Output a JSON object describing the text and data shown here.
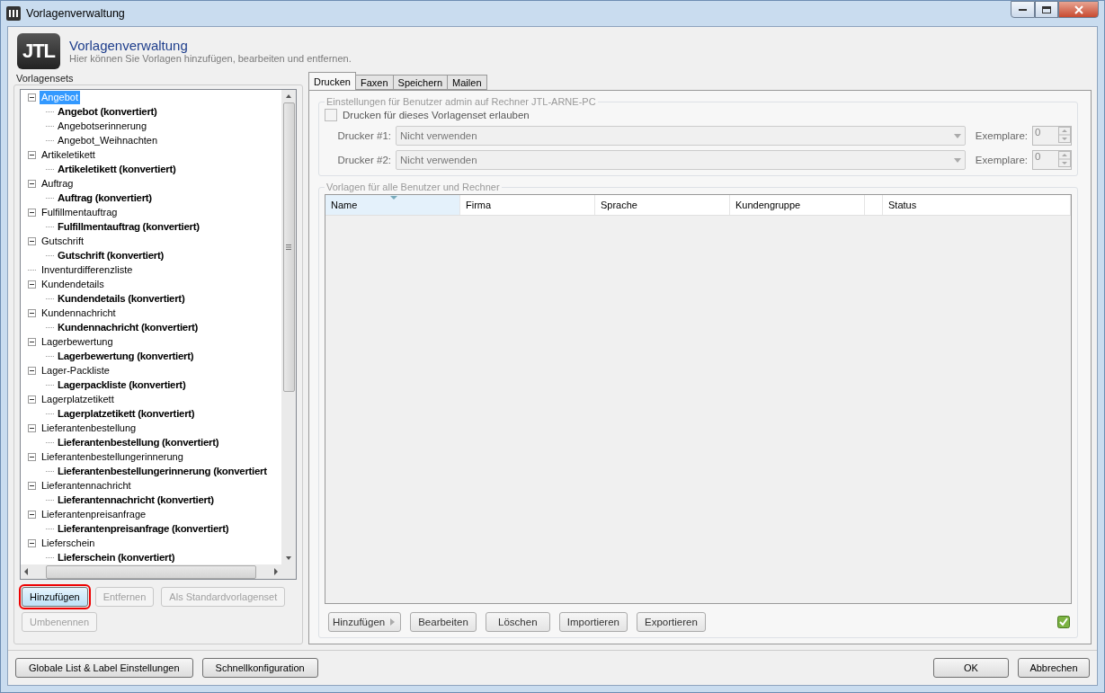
{
  "window": {
    "title": "Vorlagenverwaltung"
  },
  "header": {
    "logo": "JTL",
    "title": "Vorlagenverwaltung",
    "subtitle": "Hier können Sie Vorlagen hinzufügen, bearbeiten und entfernen."
  },
  "sidebar": {
    "title": "Vorlagensets",
    "tree": [
      {
        "label": "Angebot",
        "selected": true,
        "expanded": true,
        "children": [
          {
            "label": "Angebot (konvertiert)",
            "bold": true
          },
          {
            "label": "Angebotserinnerung",
            "bold": false
          },
          {
            "label": "Angebot_Weihnachten",
            "bold": false
          }
        ]
      },
      {
        "label": "Artikeletikett",
        "selected": false,
        "expanded": true,
        "children": [
          {
            "label": "Artikeletikett (konvertiert)",
            "bold": true
          }
        ]
      },
      {
        "label": "Auftrag",
        "selected": false,
        "expanded": true,
        "children": [
          {
            "label": "Auftrag (konvertiert)",
            "bold": true
          }
        ]
      },
      {
        "label": "Fulfillmentauftrag",
        "selected": false,
        "expanded": true,
        "children": [
          {
            "label": "Fulfillmentauftrag (konvertiert)",
            "bold": true
          }
        ]
      },
      {
        "label": "Gutschrift",
        "selected": false,
        "expanded": true,
        "children": [
          {
            "label": "Gutschrift (konvertiert)",
            "bold": true
          }
        ]
      },
      {
        "label": "Inventurdifferenzliste",
        "selected": false
      },
      {
        "label": "Kundendetails",
        "selected": false,
        "expanded": true,
        "children": [
          {
            "label": "Kundendetails (konvertiert)",
            "bold": true
          }
        ]
      },
      {
        "label": "Kundennachricht",
        "selected": false,
        "expanded": true,
        "children": [
          {
            "label": "Kundennachricht (konvertiert)",
            "bold": true
          }
        ]
      },
      {
        "label": "Lagerbewertung",
        "selected": false,
        "expanded": true,
        "children": [
          {
            "label": "Lagerbewertung (konvertiert)",
            "bold": true
          }
        ]
      },
      {
        "label": "Lager-Packliste",
        "selected": false,
        "expanded": true,
        "children": [
          {
            "label": "Lagerpackliste (konvertiert)",
            "bold": true
          }
        ]
      },
      {
        "label": "Lagerplatzetikett",
        "selected": false,
        "expanded": true,
        "children": [
          {
            "label": "Lagerplatzetikett (konvertiert)",
            "bold": true
          }
        ]
      },
      {
        "label": "Lieferantenbestellung",
        "selected": false,
        "expanded": true,
        "children": [
          {
            "label": "Lieferantenbestellung (konvertiert)",
            "bold": true
          }
        ]
      },
      {
        "label": "Lieferantenbestellungerinnerung",
        "selected": false,
        "expanded": true,
        "children": [
          {
            "label": "Lieferantenbestellungerinnerung (konvertiert",
            "bold": true
          }
        ]
      },
      {
        "label": "Lieferantennachricht",
        "selected": false,
        "expanded": true,
        "children": [
          {
            "label": "Lieferantennachricht (konvertiert)",
            "bold": true
          }
        ]
      },
      {
        "label": "Lieferantenpreisanfrage",
        "selected": false,
        "expanded": true,
        "children": [
          {
            "label": "Lieferantenpreisanfrage (konvertiert)",
            "bold": true
          }
        ]
      },
      {
        "label": "Lieferschein",
        "selected": false,
        "expanded": true,
        "children": [
          {
            "label": "Lieferschein (konvertiert)",
            "bold": true
          }
        ]
      }
    ],
    "buttons": [
      {
        "label": "Hinzufügen",
        "disabled": false,
        "highlighted": true
      },
      {
        "label": "Entfernen",
        "disabled": true,
        "highlighted": false
      },
      {
        "label": "Als Standardvorlagenset",
        "disabled": true,
        "highlighted": false
      },
      {
        "label": "Umbenennen",
        "disabled": true,
        "highlighted": false
      }
    ]
  },
  "tabs": [
    {
      "label": "Drucken",
      "selected": true
    },
    {
      "label": "Faxen",
      "selected": false
    },
    {
      "label": "Speichern",
      "selected": false
    },
    {
      "label": "Mailen",
      "selected": false
    }
  ],
  "user_settings": {
    "title": "Einstellungen für Benutzer admin auf Rechner JTL-ARNE-PC",
    "checkbox": {
      "label": "Drucken für dieses Vorlagenset erlauben",
      "checked": false
    },
    "printers": [
      {
        "label": "Drucker #1:",
        "value": "Nicht verwenden",
        "copies_label": "Exemplare:",
        "copies": "0"
      },
      {
        "label": "Drucker #2:",
        "value": "Nicht verwenden",
        "copies_label": "Exemplare:",
        "copies": "0"
      }
    ]
  },
  "templates": {
    "title": "Vorlagen für alle Benutzer und Rechner",
    "columns": [
      "Name",
      "Firma",
      "Sprache",
      "Kundengruppe",
      "Status"
    ],
    "buttons": [
      {
        "label": "Hinzufügen",
        "kind": "split"
      },
      {
        "label": "Bearbeiten",
        "kind": "plain"
      },
      {
        "label": "Löschen",
        "kind": "plain"
      },
      {
        "label": "Importieren",
        "kind": "plain"
      },
      {
        "label": "Exportieren",
        "kind": "plain"
      }
    ]
  },
  "footer": {
    "left_buttons": [
      "Globale List & Label Einstellungen",
      "Schnellkonfiguration"
    ],
    "right_buttons": [
      "OK",
      "Abbrechen"
    ]
  }
}
